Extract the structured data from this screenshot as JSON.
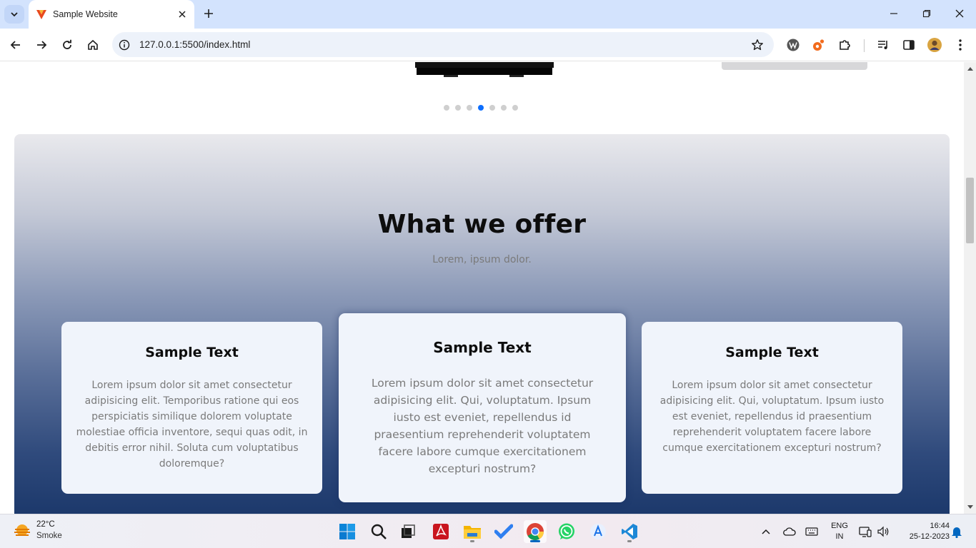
{
  "browser": {
    "tab_title": "Sample Website",
    "url": "127.0.0.1:5500/index.html"
  },
  "page": {
    "carousel": {
      "dot_count": 7,
      "active_dot_index": 3
    },
    "offer": {
      "title": "What we offer",
      "subtitle": "Lorem, ipsum dolor.",
      "cards": [
        {
          "title": "Sample Text",
          "text": "Lorem ipsum dolor sit amet consectetur adipisicing elit. Temporibus ratione qui eos perspiciatis similique dolorem voluptate molestiae officia inventore, sequi quas odit, in debitis error nihil. Soluta cum voluptatibus doloremque?"
        },
        {
          "title": "Sample Text",
          "text": "Lorem ipsum dolor sit amet consectetur adipisicing elit. Qui, voluptatum. Ipsum iusto est eveniet, repellendus id praesentium reprehenderit voluptatem facere labore cumque exercitationem excepturi nostrum?"
        },
        {
          "title": "Sample Text",
          "text": "Lorem ipsum dolor sit amet consectetur adipisicing elit. Qui, voluptatum. Ipsum iusto est eveniet, repellendus id praesentium reprehenderit voluptatem facere labore cumque exercitationem excepturi nostrum?"
        }
      ]
    }
  },
  "taskbar": {
    "weather": {
      "temp": "22°C",
      "desc": "Smoke"
    },
    "lang": {
      "line1": "ENG",
      "line2": "IN"
    },
    "clock": {
      "time": "16:44",
      "date": "25-12-2023"
    },
    "apps": [
      "start-icon",
      "search-icon",
      "task-view-icon",
      "acrobat-icon",
      "file-explorer-icon",
      "todo-icon",
      "chrome-icon",
      "whatsapp-icon",
      "app-store-icon",
      "vscode-icon"
    ]
  },
  "colors": {
    "accent": "#0d6efd",
    "tabstrip": "#d3e3fd",
    "gradient_top": "#e9e9ed",
    "gradient_bottom": "#163366",
    "card_bg": "#f0f4fb"
  }
}
